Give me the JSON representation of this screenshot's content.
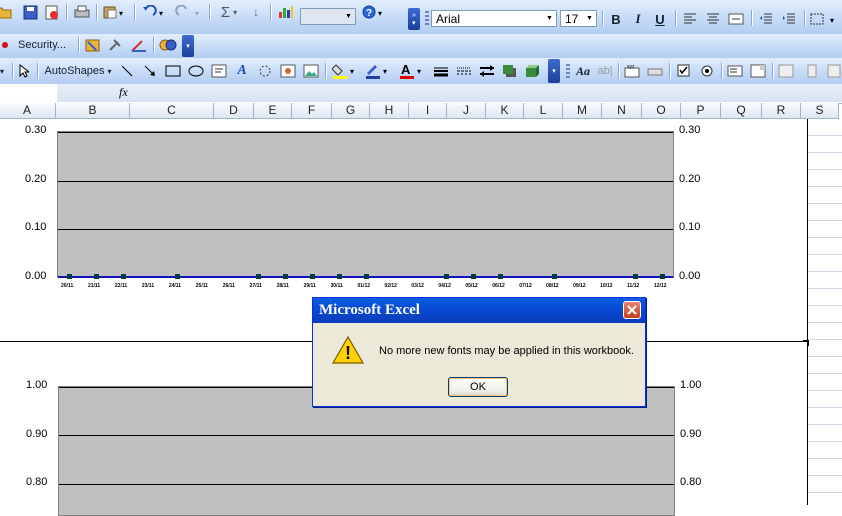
{
  "toolbar1": {
    "zoom_value": "",
    "font_name": "Arial",
    "font_size": "17",
    "bold_label": "B",
    "italic_label": "I",
    "underline_label": "U",
    "sum_label": "Σ"
  },
  "toolbar2": {
    "security_label": "Security..."
  },
  "toolbar3": {
    "autoshapes_label": "AutoShapes"
  },
  "formula_bar": {
    "name_box": "",
    "fx_label": "fx",
    "content": ""
  },
  "columns": [
    "A",
    "B",
    "C",
    "D",
    "E",
    "F",
    "G",
    "H",
    "I",
    "J",
    "K",
    "L",
    "M",
    "N",
    "O",
    "P",
    "Q",
    "R",
    "S"
  ],
  "chart_data": [
    {
      "type": "line",
      "ylim": [
        0,
        0.3
      ],
      "yticks_left": [
        "0.30",
        "0.20",
        "0.10",
        "0.00"
      ],
      "yticks_right": [
        "0.30",
        "0.20",
        "0.10",
        "0.00"
      ],
      "categories": [
        "20/11",
        "21/11",
        "22/11",
        "23/11",
        "24/11",
        "25/11",
        "26/11",
        "27/11",
        "28/11",
        "29/11",
        "30/11",
        "01/12",
        "02/12",
        "03/12",
        "04/12",
        "05/12",
        "06/12",
        "07/12",
        "08/12",
        "09/12",
        "10/12",
        "11/12",
        "12/12"
      ],
      "series": [
        {
          "values": [
            0,
            0,
            0,
            null,
            0,
            null,
            null,
            0,
            0,
            0,
            0,
            0,
            null,
            null,
            0,
            0,
            0,
            null,
            0,
            null,
            null,
            0,
            0
          ]
        }
      ],
      "grid": true
    },
    {
      "type": "line",
      "ylim": [
        0.8,
        1.0
      ],
      "yticks_left": [
        "1.00",
        "0.90",
        "0.80"
      ],
      "yticks_right": [
        "1.00",
        "0.90",
        "0.80"
      ],
      "grid": true
    }
  ],
  "dialog": {
    "title": "Microsoft Excel",
    "message": "No more new fonts may be applied in this workbook.",
    "ok_label": "OK",
    "warning_glyph": "!"
  }
}
